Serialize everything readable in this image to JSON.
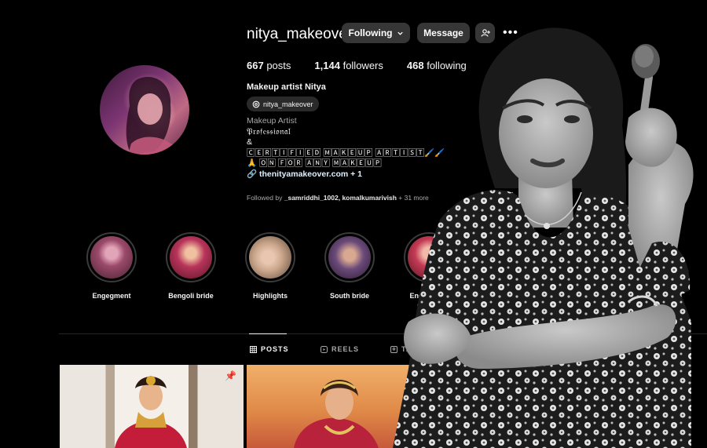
{
  "profile": {
    "username": "nitya_makeover",
    "follow_label": "Following",
    "message_label": "Message",
    "stats": {
      "posts": "667",
      "posts_label": "posts",
      "followers": "1,144",
      "followers_label": "followers",
      "following": "468",
      "following_label": "following"
    },
    "full_name": "Makeup artist Nitya",
    "threads_handle": "nitya_makeover",
    "bio": {
      "category": "Makeup Artist",
      "line1": "𝔓𝔯𝔬𝔣𝔢𝔰𝔰𝔦𝔬𝔫𝔞𝔩",
      "line2": "&",
      "line3": "🄲🄴🅁🅃🄸🄵🄸🄴🄳 🄼🄰🄺🄴🅄🄿 🄰🅁🅃🄸🅂🅃🖌️🖌️",
      "line4": "🙏 🄾🄽 🄵🄾🅁 🄰🄽🅈 🄼🄰🄺🄴🅄🄿",
      "link": "thenityamakeover.com + 1"
    },
    "followed_by": {
      "prefix": "Followed by",
      "names": "_samriddhi_1002, komalkumarivish",
      "more": "+ 31 more"
    }
  },
  "highlights": [
    {
      "label": "Engegment",
      "color": "#9b4a6a"
    },
    {
      "label": "Bengoli bride",
      "color": "#b8345a"
    },
    {
      "label": "Highlights",
      "color": "#c9a58a"
    },
    {
      "label": "South bride",
      "color": "#6b4a7a"
    },
    {
      "label": "Engegment",
      "color": "#c43a55"
    }
  ],
  "tabs": {
    "posts": "POSTS",
    "reels": "REELS",
    "tagged": "TA"
  },
  "icons": [
    "chevron-down-icon",
    "add-person-icon",
    "more-icon",
    "threads-icon",
    "link-icon",
    "grid-icon",
    "reels-icon",
    "tagged-icon",
    "pin-icon"
  ]
}
